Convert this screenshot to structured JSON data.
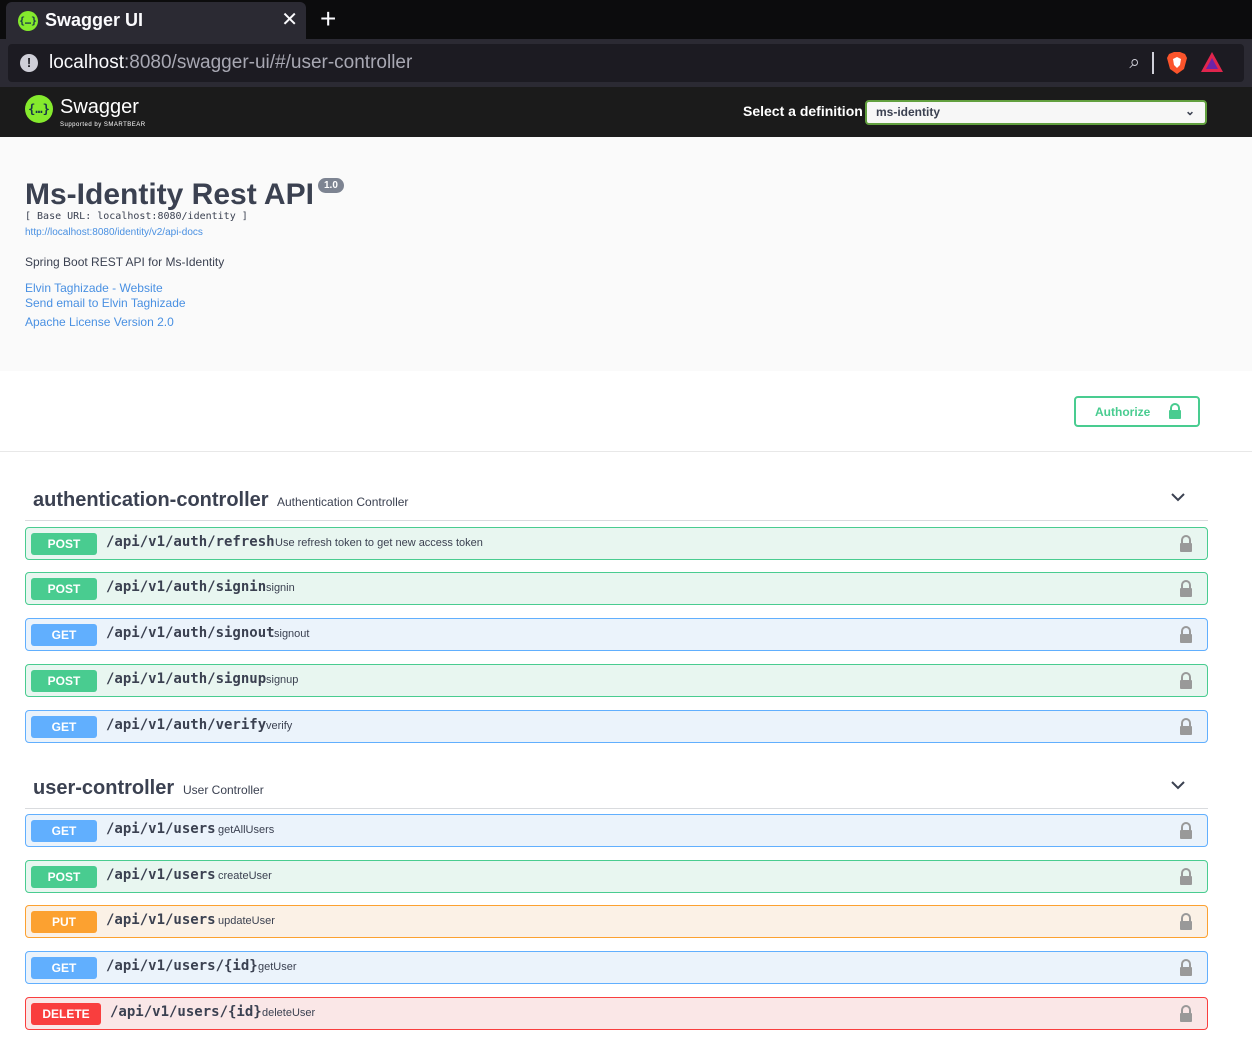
{
  "browser": {
    "tab_title": "Swagger UI",
    "tab_icon": "{…}",
    "close_glyph": "✕",
    "new_tab_glyph": "+",
    "url_host": "localhost",
    "url_rest": ":8080/swagger-ui/#/user-controller",
    "warning_glyph": "!",
    "zoom_glyph": "⌕"
  },
  "topbar": {
    "logo_text": "Swagger",
    "logo_icon": "{…}",
    "logo_sub": "Supported by SMARTBEAR",
    "definition_label": "Select a definition",
    "definition_value": "ms-identity",
    "chevron_glyph": "⌄"
  },
  "info": {
    "title": "Ms-Identity Rest API",
    "version": "1.0",
    "base_url": "[ Base URL: localhost:8080/identity ]",
    "docs_link": "http://localhost:8080/identity/v2/api-docs",
    "description": "Spring Boot REST API for Ms-Identity",
    "website_link": "Elvin Taghizade - Website",
    "email_link": "Send email to Elvin Taghizade",
    "license_link": "Apache License Version 2.0"
  },
  "auth": {
    "button_label": "Authorize"
  },
  "controllers": [
    {
      "name": "authentication-controller",
      "description": "Authentication Controller",
      "operations": [
        {
          "method": "POST",
          "path": "/api/v1/auth/refresh",
          "summary": "Use refresh token to get new access token"
        },
        {
          "method": "POST",
          "path": "/api/v1/auth/signin",
          "summary": "signin"
        },
        {
          "method": "GET",
          "path": "/api/v1/auth/signout",
          "summary": "signout"
        },
        {
          "method": "POST",
          "path": "/api/v1/auth/signup",
          "summary": "signup"
        },
        {
          "method": "GET",
          "path": "/api/v1/auth/verify",
          "summary": "verify"
        }
      ]
    },
    {
      "name": "user-controller",
      "description": "User Controller",
      "operations": [
        {
          "method": "GET",
          "path": "/api/v1/users",
          "summary": "getAllUsers"
        },
        {
          "method": "POST",
          "path": "/api/v1/users",
          "summary": "createUser"
        },
        {
          "method": "PUT",
          "path": "/api/v1/users",
          "summary": "updateUser"
        },
        {
          "method": "GET",
          "path": "/api/v1/users/{id}",
          "summary": "getUser"
        },
        {
          "method": "DELETE",
          "path": "/api/v1/users/{id}",
          "summary": "deleteUser"
        }
      ]
    }
  ],
  "colors": {
    "post": "#49cc90",
    "get": "#61affe",
    "put": "#fca130",
    "delete": "#f93e3e",
    "link": "#4990e2",
    "text": "#3b4151"
  }
}
